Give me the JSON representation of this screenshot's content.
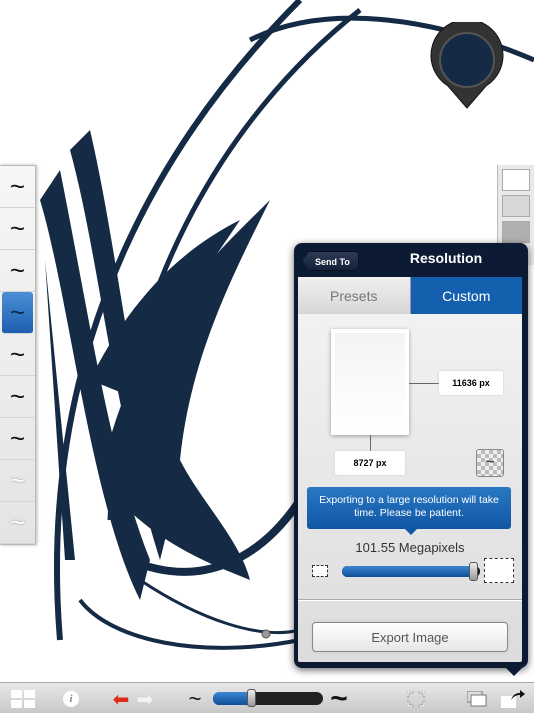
{
  "colors": {
    "ink": "#152a45",
    "accent": "#1460ae"
  },
  "brush_palette": {
    "items": [
      "~",
      "~",
      "~",
      "~",
      "~",
      "~",
      "~",
      "~",
      "~"
    ],
    "selected_index": 3
  },
  "color_strip": {
    "swatches": [
      "#ffffff",
      "#d8d8d8",
      "#b0b0b0"
    ]
  },
  "color_puck": {
    "color": "#152a45"
  },
  "popover": {
    "back_label": "Send To",
    "title": "Resolution",
    "tabs": [
      {
        "label": "Presets",
        "selected": false
      },
      {
        "label": "Custom",
        "selected": true
      }
    ],
    "height_value": "11636 px",
    "width_value": "8727 px",
    "swap_icon": "swap-orientation-icon",
    "tooltip": "Exporting to a large resolution will take time.  Please be patient.",
    "megapixels_label": "101.55 Megapixels",
    "size_slider_percent": 96,
    "export_label": "Export Image"
  },
  "toolbar": {
    "icons": [
      "layout-grid-icon",
      "info-icon",
      "undo-icon",
      "redo-icon",
      "brush-thin-icon",
      "brush-thick-icon",
      "fullscreen-icon",
      "layers-icon",
      "share-icon"
    ],
    "info_glyph": "i",
    "brush_size_percent": 35
  }
}
